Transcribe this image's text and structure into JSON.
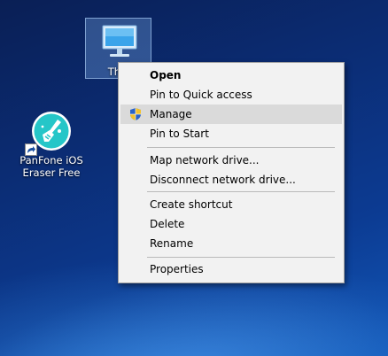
{
  "desktop": {
    "icons": [
      {
        "label": "This PC",
        "visible_label": "This",
        "icon": "computer-monitor-icon"
      },
      {
        "label_line1": "PanFone iOS",
        "label_line2": "Eraser Free",
        "icon": "panfone-eraser-icon"
      }
    ]
  },
  "context_menu": {
    "items": [
      {
        "label": "Open",
        "bold": true
      },
      {
        "label": "Pin to Quick access"
      },
      {
        "label": "Manage",
        "icon": "uac-shield-icon",
        "hovered": true
      },
      {
        "label": "Pin to Start"
      },
      {
        "label": "Map network drive..."
      },
      {
        "label": "Disconnect network drive..."
      },
      {
        "label": "Create shortcut"
      },
      {
        "label": "Delete"
      },
      {
        "label": "Rename"
      },
      {
        "label": "Properties"
      }
    ]
  },
  "colors": {
    "menu_bg": "#f2f2f2",
    "menu_hover": "#dadada",
    "selection": "#78aae6",
    "desktop_dark": "#0a1f55",
    "desktop_light": "#1157b8"
  }
}
